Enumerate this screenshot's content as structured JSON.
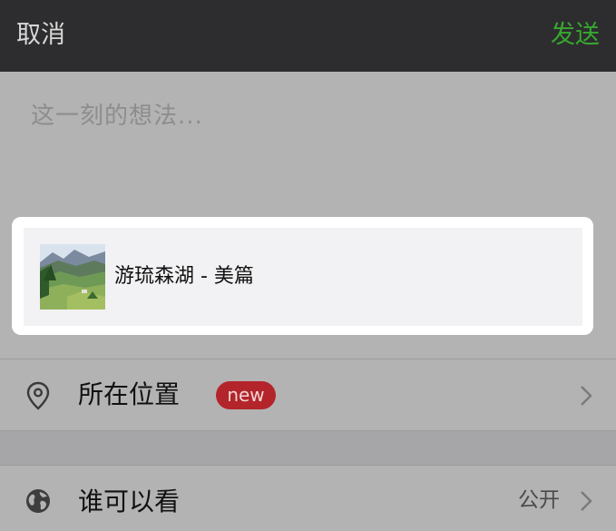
{
  "header": {
    "cancel_label": "取消",
    "send_label": "发送"
  },
  "compose": {
    "placeholder": "这一刻的想法..."
  },
  "shared_link": {
    "title": "游琉森湖 - 美篇",
    "thumbnail_icon": "landscape-thumbnail"
  },
  "location_row": {
    "icon": "location-pin-icon",
    "label": "所在位置",
    "badge": "new"
  },
  "visibility_row": {
    "icon": "globe-icon",
    "label": "谁可以看",
    "value": "公开"
  },
  "colors": {
    "top_bar": "#2d2d2f",
    "send_accent": "#37a82f",
    "badge_red": "#b3252a",
    "overlay_gray": "#b3b3b3"
  }
}
